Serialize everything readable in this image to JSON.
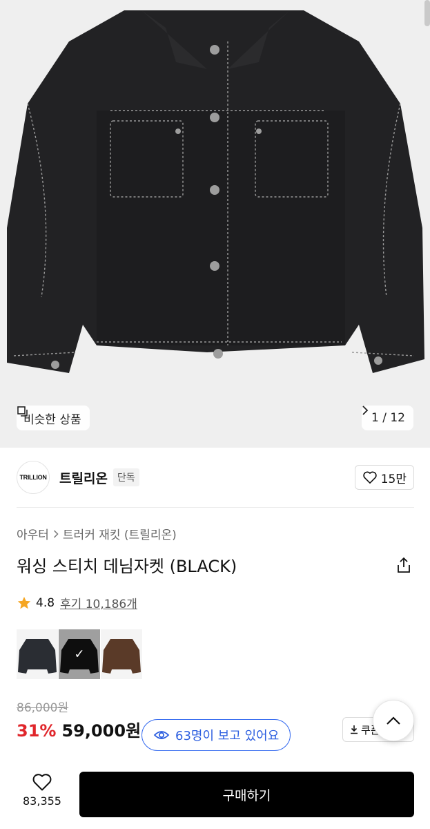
{
  "hero": {
    "similar_label": "비슷한 상품",
    "pager": "1 / 12"
  },
  "brand": {
    "logo_text": "TRILLION",
    "name": "트릴리온",
    "badge": "단독",
    "likes": "15만"
  },
  "breadcrumb": [
    "아우터",
    "트러커 재킷 (트릴리온)"
  ],
  "product": {
    "title": "워싱 스티치 데님자켓 (BLACK)",
    "rating": "4.8",
    "review_label": "후기 10,186개",
    "colors": [
      {
        "name": "navy",
        "color": "#2a2d33"
      },
      {
        "name": "black",
        "color": "#161616"
      },
      {
        "name": "brown",
        "color": "#5a3a28"
      }
    ],
    "selected_color_index": 1
  },
  "price": {
    "original": "86,000원",
    "discount": "31%",
    "sale": "59,000원"
  },
  "viewers": "63명이 보고 있어요",
  "coupon_label": "쿠폰",
  "bottom": {
    "like_count": "83,355",
    "buy_label": "구매하기"
  },
  "colors": {
    "accent_blue": "#2d5fe0",
    "discount_red": "#e0262b",
    "star": "#f5a623"
  }
}
